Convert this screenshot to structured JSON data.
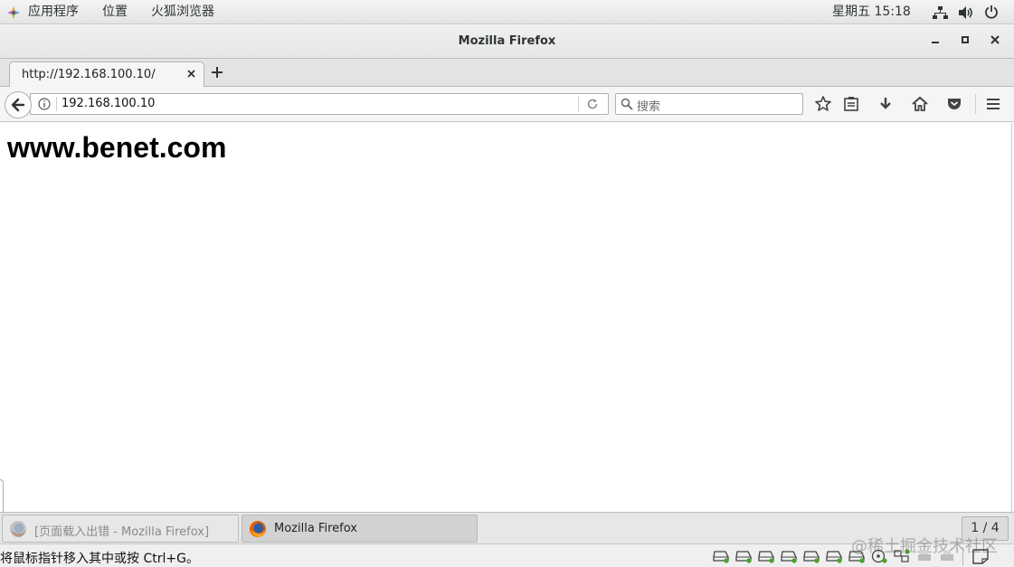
{
  "topbar": {
    "apps_label": "应用程序",
    "places_label": "位置",
    "browser_label": "火狐浏览器",
    "clock": "星期五 15:18",
    "icons": [
      "network-icon",
      "volume-icon",
      "power-icon"
    ]
  },
  "window": {
    "title": "Mozilla Firefox",
    "controls": [
      "minimize",
      "maximize",
      "close"
    ]
  },
  "tabs": [
    {
      "label": "http://192.168.100.10/",
      "active": true
    }
  ],
  "navbar": {
    "url": "192.168.100.10",
    "search_placeholder": "搜索",
    "toolbar_icons": [
      "bookmark-star-icon",
      "reading-list-icon",
      "download-icon",
      "home-icon",
      "pocket-icon",
      "menu-icon"
    ]
  },
  "page": {
    "heading": "www.benet.com"
  },
  "window_list": {
    "items": [
      {
        "label": "[页面载入出错 - Mozilla Firefox]",
        "active": false
      },
      {
        "label": "Mozilla Firefox",
        "active": true
      }
    ],
    "pager": "1 / 4"
  },
  "statusbar": {
    "message": "将鼠标指针移入其中或按 Ctrl+G。",
    "watermark": "@稀土掘金技术社区"
  },
  "colors": {
    "accent_green": "#4ca12b",
    "panel_bg": "#e7e7e7",
    "firefox_orange": "#e66000"
  }
}
